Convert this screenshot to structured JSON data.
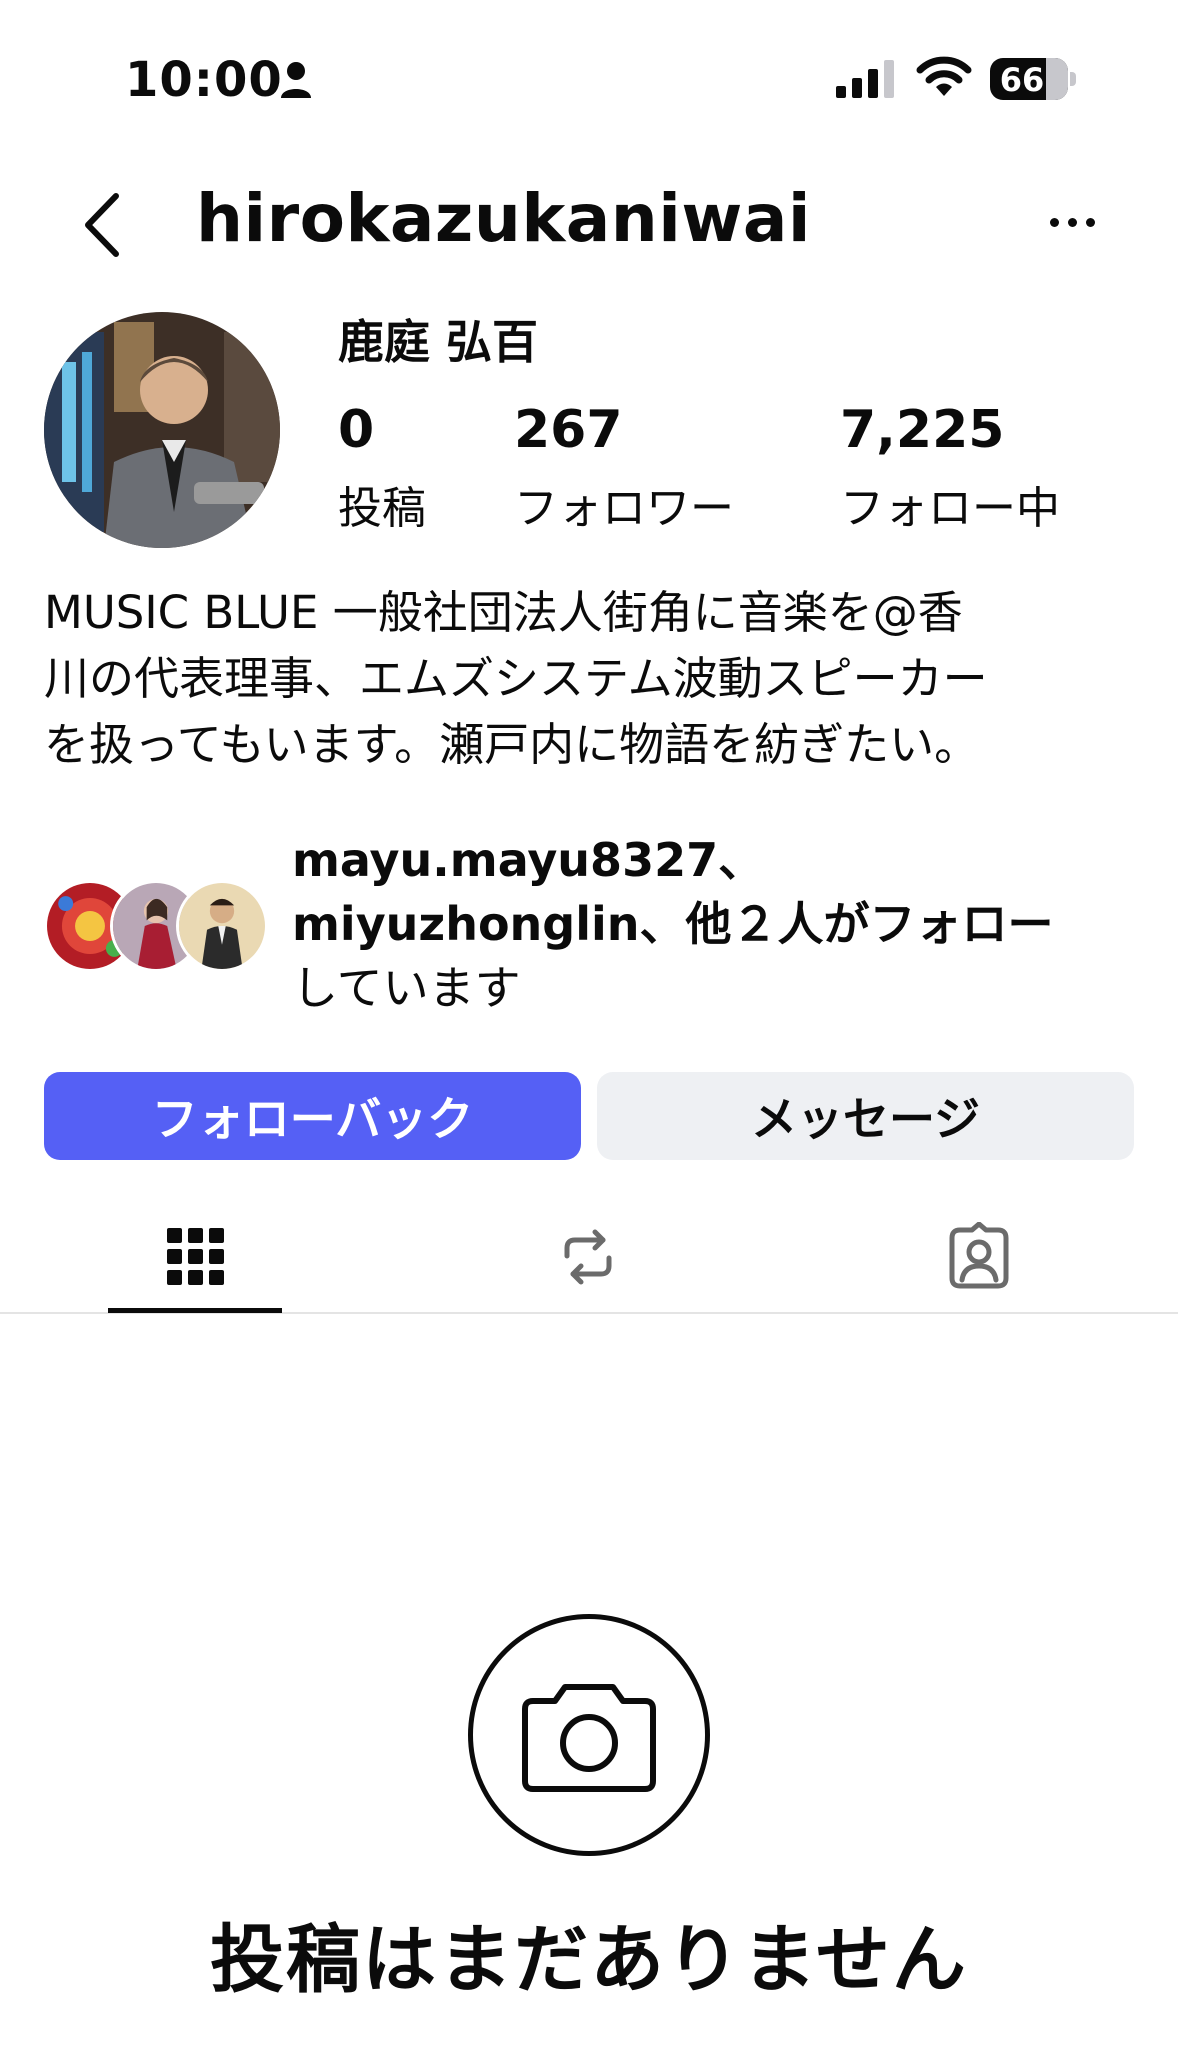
{
  "status_bar": {
    "time": "10:00",
    "battery": "66",
    "icons": [
      "person-icon",
      "signal-icon",
      "wifi-icon",
      "battery-icon"
    ]
  },
  "header": {
    "username": "hirokazukaniwai",
    "back_icon": "chevron-left-icon",
    "more_icon": "more-horizontal-icon"
  },
  "profile": {
    "display_name": "鹿庭 弘百",
    "stats": [
      {
        "value": "0",
        "label": "投稿"
      },
      {
        "value": "267",
        "label": "フォロワー"
      },
      {
        "value": "7,225",
        "label": "フォロー中"
      }
    ],
    "bio": "MUSIC BLUE 一般社団法人街角に音楽を@香\n川の代表理事、エムズシステム波動スピーカー\nを扱ってもいます。瀬戸内に物語を紡ぎたい。"
  },
  "mutual": {
    "names_1": "mayu.mayu8327、",
    "names_2": "miyuzhonglin",
    "suffix": "、他２人がフォロー",
    "suffix_2": "しています"
  },
  "actions": {
    "follow_back": "フォローバック",
    "message": "メッセージ"
  },
  "tabs": [
    "grid-icon",
    "reels-icon",
    "tagged-icon"
  ],
  "empty_state": {
    "title": "投稿はまだありません",
    "icon": "camera-icon"
  },
  "colors": {
    "accent": "#5560f5",
    "secondary_button": "#eef0f3",
    "text": "#0b0b0b"
  }
}
